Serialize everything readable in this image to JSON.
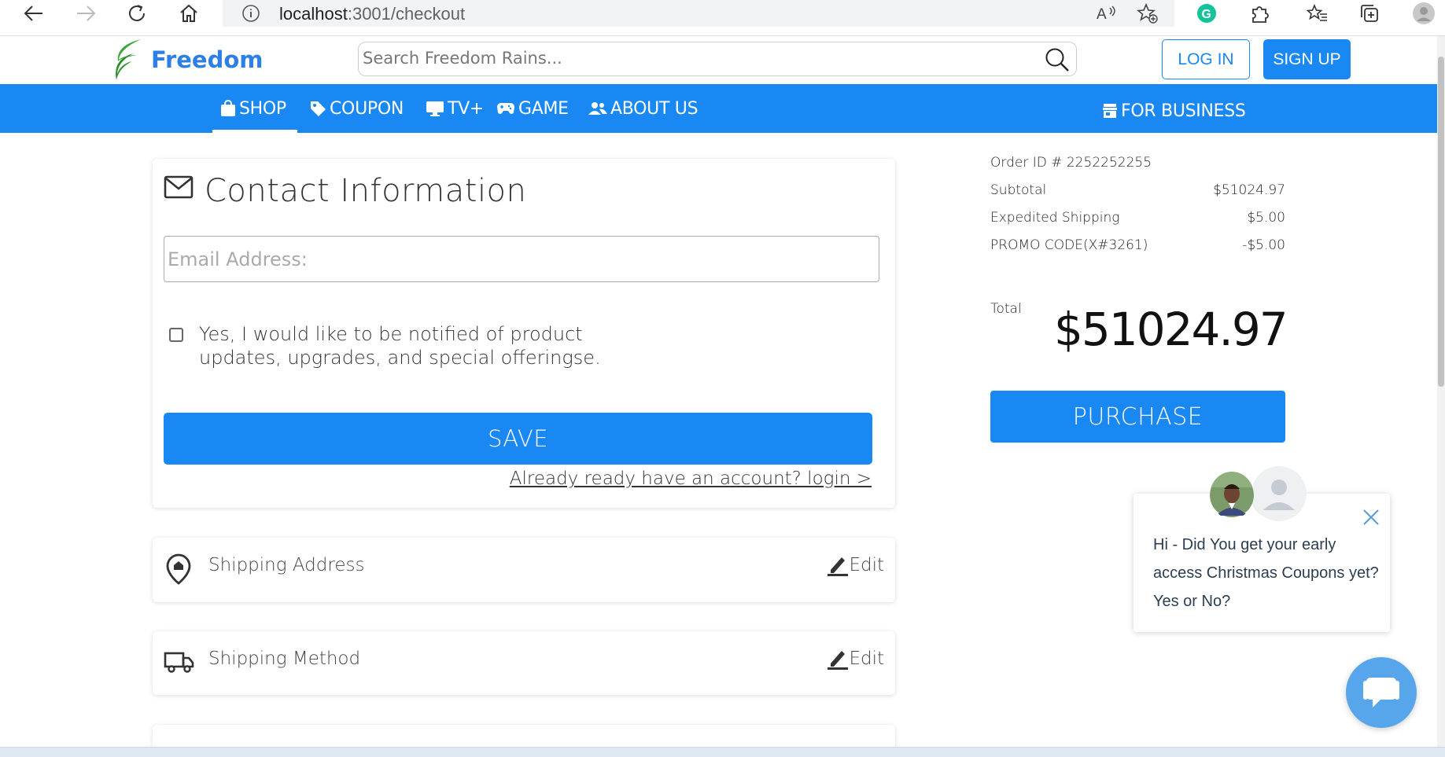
{
  "browser": {
    "url_host": "localhost",
    "url_path": ":3001/checkout",
    "icons": [
      "back-icon",
      "forward-icon",
      "reload-icon",
      "home-icon",
      "info-icon",
      "read-aloud-icon",
      "favorite-add-icon",
      "grammarly-icon",
      "extensions-icon",
      "favorites-icon",
      "collections-icon",
      "profile-icon"
    ]
  },
  "header": {
    "brand": "Freedom",
    "search_placeholder": "Search Freedom Rains...",
    "login_label": "LOG IN",
    "signup_label": "SIGN UP"
  },
  "nav": {
    "items": [
      {
        "label": "SHOP",
        "icon": "shopping-bag-icon",
        "active": true
      },
      {
        "label": "COUPON",
        "icon": "tag-icon"
      },
      {
        "label": "TV+",
        "icon": "monitor-icon"
      },
      {
        "label": "GAME",
        "icon": "gamepad-icon"
      },
      {
        "label": "ABOUT US",
        "icon": "people-icon"
      }
    ],
    "business_label": "FOR BUSINESS"
  },
  "contact": {
    "title": "Contact Information",
    "email_placeholder": "Email Address:",
    "checkbox_label": "Yes, I would like to be notified of product updates, upgrades, and special offeringse.",
    "save_label": "SAVE",
    "login_link": "Already ready have an account? login >"
  },
  "sections": [
    {
      "label": "Shipping Address",
      "icon": "location-pin-icon",
      "edit_label": "Edit"
    },
    {
      "label": "Shipping Method",
      "icon": "truck-icon",
      "edit_label": "Edit"
    }
  ],
  "summary": {
    "order_id": "Order ID # 2252252255",
    "rows": [
      {
        "label": "Subtotal",
        "value": "$51024.97"
      },
      {
        "label": "Expedited Shipping",
        "value": "$5.00"
      },
      {
        "label": "PROMO CODE(X#3261)",
        "value": "-$5.00"
      }
    ],
    "total_label": "Total",
    "total_value": "$51024.97",
    "purchase_label": "PURCHASE"
  },
  "chat": {
    "message": "Hi - Did You get your early access Christmas Coupons yet? Yes or No?"
  },
  "colors": {
    "accent": "#1a88f3",
    "brand_text": "#2d7fe6",
    "logo_green": "#3aa63a",
    "chat_launcher": "#57a6ec"
  }
}
